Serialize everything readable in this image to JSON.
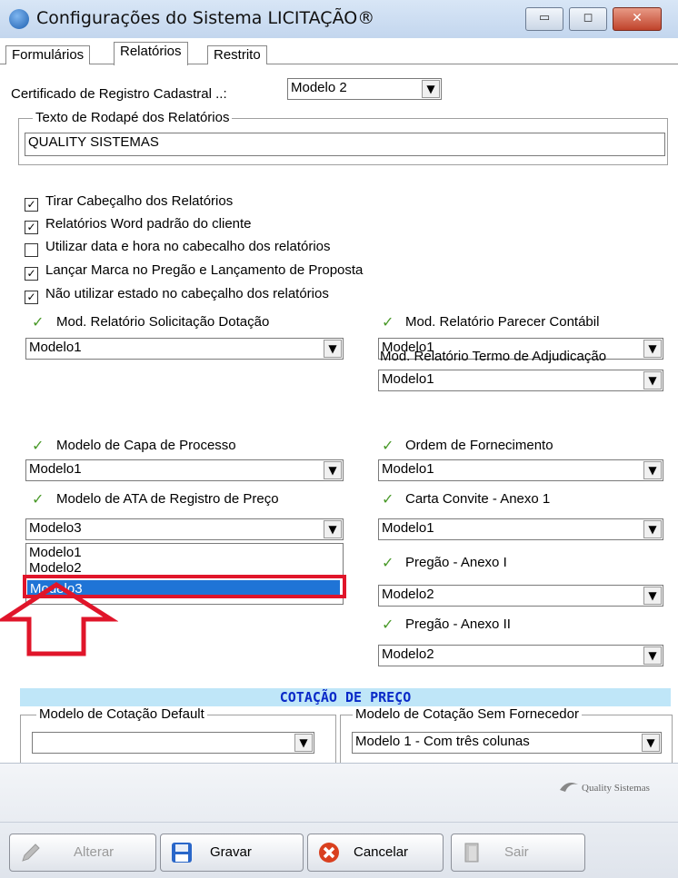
{
  "window": {
    "title": "Configurações do Sistema LICITAÇÃO®",
    "minimize_symbol": "▭",
    "maximize_symbol": "◻",
    "close_symbol": "✕"
  },
  "tabs": [
    "Formulários",
    "Relatórios",
    "Restrito"
  ],
  "certificado": {
    "label": "Certificado de Registro Cadastral ..:",
    "value": "Modelo 2"
  },
  "rodape": {
    "group_label": "Texto de  Rodapé dos Relatórios",
    "value": "QUALITY SISTEMAS"
  },
  "checkboxes": [
    {
      "label": "Tirar Cabeçalho dos Relatórios",
      "checked": true,
      "mark": "✓"
    },
    {
      "label": "Relatórios Word padrão do cliente",
      "checked": true,
      "mark": "✓"
    },
    {
      "label": "Utilizar data e hora no cabecalho dos relatórios",
      "checked": false,
      "mark": ""
    },
    {
      "label": "Lançar Marca no Pregão e Lançamento de Proposta",
      "checked": true,
      "mark": "✓"
    },
    {
      "label": "Não utilizar estado no cabeçalho dos relatórios",
      "checked": true,
      "mark": "✓"
    }
  ],
  "left_fields": [
    {
      "label": "Mod. Relatório Solicitação Dotação",
      "value": "Modelo1"
    },
    {
      "label": "Modelo de Capa de Processo",
      "value": "Modelo1"
    },
    {
      "label": "Modelo de ATA de Registro de Preço",
      "value": "Modelo3"
    }
  ],
  "right_fields": [
    {
      "label": "Mod. Relatório Parecer Contábil",
      "value": "Modelo1"
    },
    {
      "label": "Mod. Relatório Termo de Adjudicação",
      "value": "Modelo1"
    },
    {
      "label": "Ordem de Fornecimento",
      "value": "Modelo1"
    },
    {
      "label": "Carta Convite - Anexo 1",
      "value": "Modelo1"
    },
    {
      "label": "Pregão - Anexo I",
      "value": "Modelo2"
    },
    {
      "label": "Pregão - Anexo II",
      "value": "Modelo2"
    }
  ],
  "dropdown_options": [
    "Modelo1",
    "Modelo2",
    "Modelo3"
  ],
  "dropdown_selected": "Modelo3",
  "cotacao": {
    "section_title": "COTAÇÃO DE PREÇO",
    "default_label": "Modelo de Cotação Default",
    "default_value": "",
    "sem_fornecedor_label": "Modelo de Cotação Sem Fornecedor",
    "sem_fornecedor_value": "Modelo 1 - Com três colunas"
  },
  "logo_text": "Quality Sistemas",
  "buttons": [
    {
      "label": "Alterar",
      "enabled": false
    },
    {
      "label": "Gravar",
      "enabled": true
    },
    {
      "label": "Cancelar",
      "enabled": true
    },
    {
      "label": "Sair",
      "enabled": false
    }
  ],
  "dropdown_arrow": "▼",
  "colors": {
    "accent_red": "#e0152a",
    "selection_blue": "#1f74d6",
    "section_text": "#0a2ac8",
    "tick_green": "#4a9a2a"
  }
}
